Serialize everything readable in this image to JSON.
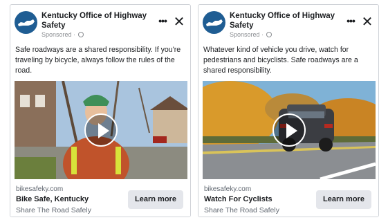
{
  "ads": [
    {
      "page_name": "Kentucky Office of Highway Safety",
      "sponsored": "Sponsored · ",
      "more_icon": "more-horizontal-icon",
      "close_icon": "close-icon",
      "body": "Safe roadways are a shared responsibility. If you're traveling by bicycle, always follow the rules of the road.",
      "domain": "bikesafeky.com",
      "headline": "Bike Safe, Kentucky",
      "description": "Share The Road Safely",
      "cta": "Learn more"
    },
    {
      "page_name": "Kentucky Office of Highway Safety",
      "sponsored": "Sponsored · ",
      "more_icon": "more-horizontal-icon",
      "close_icon": "close-icon",
      "body": "Whatever kind of vehicle you drive, watch for pedestrians and bicyclists. Safe roadways are a shared responsibility.",
      "domain": "bikesafeky.com",
      "headline": "Watch For Cyclists",
      "description": "Share The Road Safely",
      "cta": "Learn more"
    }
  ],
  "colors": {
    "logo_blue": "#1f5d93",
    "cta_bg": "#e4e6eb",
    "secondary_text": "#606770"
  }
}
